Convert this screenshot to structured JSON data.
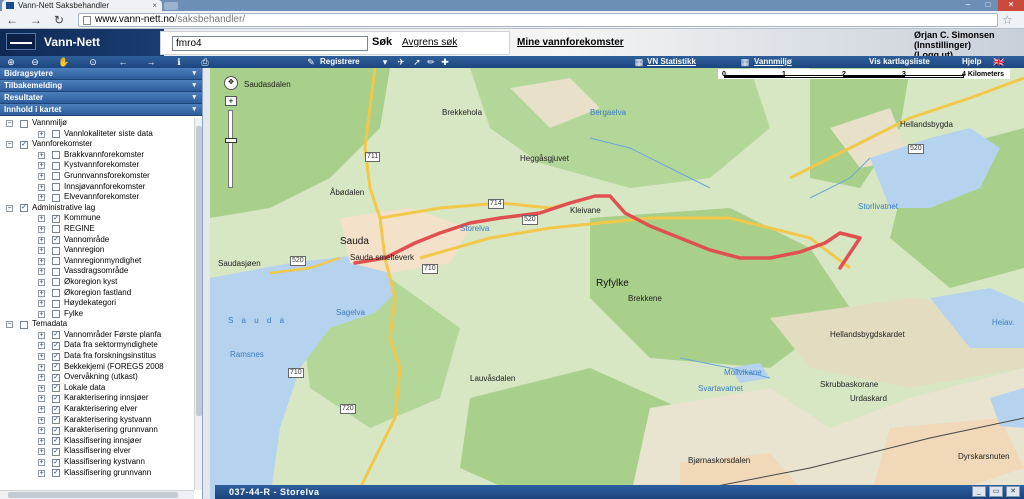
{
  "browser": {
    "tab_title": "Vann-Nett Saksbehandler",
    "tab_close": "×",
    "url_domain": "www.vann-nett.no",
    "url_path": "/saksbehandler/",
    "back": "←",
    "forward": "→",
    "reload": "↻",
    "star": "☆",
    "wrench": "🔧",
    "win_min": "–",
    "win_max": "□",
    "win_close": "✕"
  },
  "header": {
    "logo": "Vann-Nett",
    "search_value": "fmro4",
    "search_button": "Søk",
    "clear_search": "Avgrens søk",
    "my_waterbodies": "Mine vannforekomster",
    "user_name": "Ørjan C. Simonsen",
    "settings": "(Innstillinger)",
    "logout": "(Logg ut)"
  },
  "toolbar": {
    "register": "Registrere",
    "stats": "VN Statistikk",
    "env": "Vannmiljø",
    "layers": "Vis kartlagsliste",
    "help": "Hjelp"
  },
  "sidebar": {
    "accordions": [
      "Bidragsytere",
      "Tilbakemelding",
      "Resultater",
      "Innhold i kartet"
    ],
    "chevron": "▾",
    "tree": [
      {
        "level": 0,
        "label": "Vannmiljø",
        "checked": false,
        "exp": "−"
      },
      {
        "level": 1,
        "label": "Vannlokaliteter siste data",
        "checked": false,
        "exp": "+"
      },
      {
        "level": 0,
        "label": "Vannforekomster",
        "checked": true,
        "exp": "−"
      },
      {
        "level": 1,
        "label": "Brakkvannforekomster",
        "checked": false,
        "exp": "+"
      },
      {
        "level": 1,
        "label": "Kystvannforekomster",
        "checked": false,
        "exp": "+"
      },
      {
        "level": 1,
        "label": "Grunnvannsforekomster",
        "checked": false,
        "exp": "+"
      },
      {
        "level": 1,
        "label": "Innsjøvannforekomster",
        "checked": false,
        "exp": "+"
      },
      {
        "level": 1,
        "label": "Elvevannforekomster",
        "checked": false,
        "exp": "+"
      },
      {
        "level": 0,
        "label": "Administrative lag",
        "checked": true,
        "exp": "−"
      },
      {
        "level": 1,
        "label": "Kommune",
        "checked": true,
        "exp": "+"
      },
      {
        "level": 1,
        "label": "REGINE",
        "checked": false,
        "exp": "+"
      },
      {
        "level": 1,
        "label": "Vannområde",
        "checked": true,
        "exp": "+"
      },
      {
        "level": 1,
        "label": "Vannregion",
        "checked": false,
        "exp": "+"
      },
      {
        "level": 1,
        "label": "Vannregionmyndighet",
        "checked": false,
        "exp": "+"
      },
      {
        "level": 1,
        "label": "Vassdragsområde",
        "checked": false,
        "exp": "+"
      },
      {
        "level": 1,
        "label": "Økoregion kyst",
        "checked": false,
        "exp": "+"
      },
      {
        "level": 1,
        "label": "Økoregion fastland",
        "checked": false,
        "exp": "+"
      },
      {
        "level": 1,
        "label": "Høydekategori",
        "checked": false,
        "exp": "+"
      },
      {
        "level": 1,
        "label": "Fylke",
        "checked": false,
        "exp": "+"
      },
      {
        "level": 0,
        "label": "Temadata",
        "checked": false,
        "exp": "−"
      },
      {
        "level": 1,
        "label": "Vannområder Første planfa",
        "checked": true,
        "exp": "+"
      },
      {
        "level": 1,
        "label": "Data fra sektormyndighete",
        "checked": true,
        "exp": "+"
      },
      {
        "level": 1,
        "label": "Data fra forskningsinstitus",
        "checked": true,
        "exp": "+"
      },
      {
        "level": 1,
        "label": "Bekkekjemi (FOREGS 2008",
        "checked": true,
        "exp": "+"
      },
      {
        "level": 1,
        "label": "Overvåkning (utkast)",
        "checked": true,
        "exp": "+"
      },
      {
        "level": 1,
        "label": "Lokale data",
        "checked": true,
        "exp": "+"
      },
      {
        "level": 1,
        "label": "Karakterisering innsjøer",
        "checked": true,
        "exp": "+"
      },
      {
        "level": 1,
        "label": "Karakterisering elver",
        "checked": true,
        "exp": "+"
      },
      {
        "level": 1,
        "label": "Karakterisering kystvann",
        "checked": true,
        "exp": "+"
      },
      {
        "level": 1,
        "label": "Karakterisering grunnvann",
        "checked": true,
        "exp": "+"
      },
      {
        "level": 1,
        "label": "Klassifisering innsjøer",
        "checked": true,
        "exp": "+"
      },
      {
        "level": 1,
        "label": "Klassifisering elver",
        "checked": true,
        "exp": "+"
      },
      {
        "level": 1,
        "label": "Klassifisering kystvann",
        "checked": true,
        "exp": "+"
      },
      {
        "level": 1,
        "label": "Klassifisering grunnvann",
        "checked": true,
        "exp": "+"
      }
    ]
  },
  "map": {
    "labels": {
      "sauda_top": "Saudasdalen",
      "brekkehola": "Brekkehola",
      "bergaelva": "Bergaelva",
      "heggasgjuvet": "Heggåsgjuvet",
      "abodalen": "Åbødalen",
      "sauda": "Sauda",
      "saudasjoen": "Saudasjøen",
      "saudasmelteverk": "Sauda smelteverk",
      "kleivane": "Kleivane",
      "ryfylke": "Ryfylke",
      "brekkene": "Brekkene",
      "storelva_lbl": "Storelva",
      "hellandsbygda": "Hellandsbygda",
      "storlivatnet": "Storlivatnet",
      "sauda_fjord": "S a u d a",
      "sagelva": "Sagelva",
      "ramsnes": "Ramsnes",
      "lauvasdalen": "Lauvåsdalen",
      "mollvikane": "Mollvikane",
      "svartavatnet": "Svartavatnet",
      "skrubbaskorane": "Skrubbaskorane",
      "urdaskard": "Urdaskard",
      "hellandsbygdskardet": "Hellandsbygdskardet",
      "bjornaskorsdalen": "Bjørnaskorsdalen",
      "dyrskar": "Dyrskarsnuten",
      "heiavatnet": "Heiav.",
      "road711": "711",
      "road714": "714",
      "road520a": "520",
      "road520b": "520",
      "road520c": "520",
      "road710a": "710",
      "road710b": "710",
      "road720": "720"
    },
    "scale_ticks": [
      "0",
      "1",
      "2",
      "3",
      "4 Kilometers"
    ],
    "zoom_in": "+",
    "zoom_out": "−",
    "pan": "✥",
    "status_title": "037-44-R - Storelva"
  },
  "colors": {
    "land": "#cfe3b8",
    "forest": "#a9d18e",
    "water": "#b5d3ee",
    "road": "#f2c84b",
    "river_highlight": "#e05050",
    "brand": "#1d4680"
  }
}
